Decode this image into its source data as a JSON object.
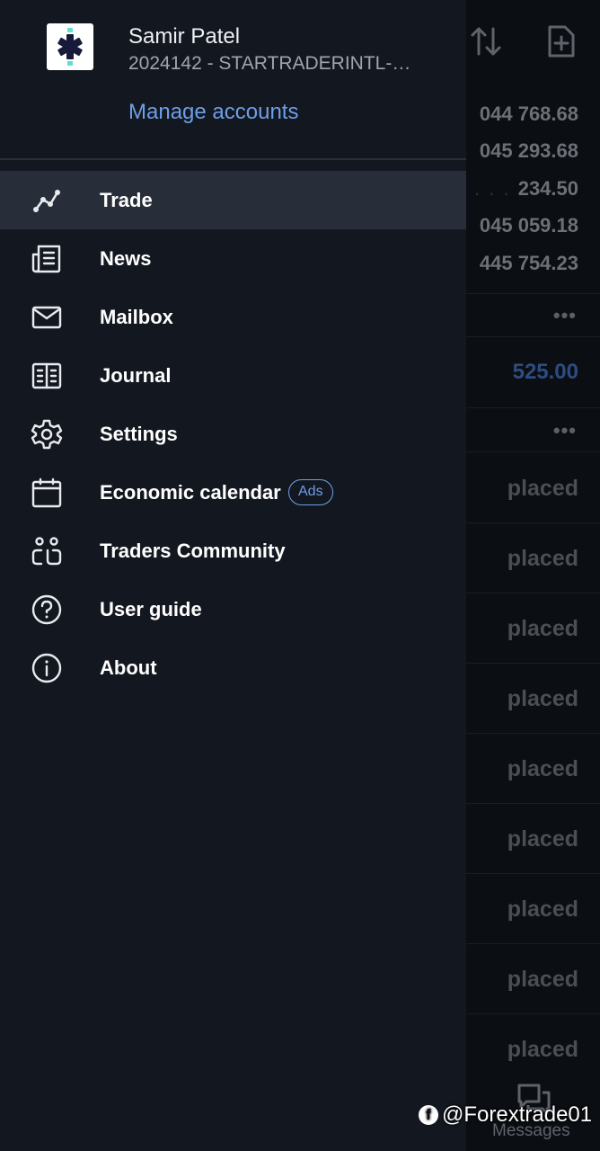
{
  "drawer": {
    "user_name": "Samir Patel",
    "account_id": "2024142 - STARTRADERINTL-…",
    "manage_accounts": "Manage accounts",
    "menu": [
      {
        "label": "Trade",
        "icon": "chart-line-icon",
        "active": true
      },
      {
        "label": "News",
        "icon": "news-icon"
      },
      {
        "label": "Mailbox",
        "icon": "mail-icon"
      },
      {
        "label": "Journal",
        "icon": "journal-icon"
      },
      {
        "label": "Settings",
        "icon": "gear-icon"
      },
      {
        "label": "Economic calendar",
        "icon": "calendar-icon",
        "badge": "Ads"
      },
      {
        "label": "Traders Community",
        "icon": "community-icon"
      },
      {
        "label": "User guide",
        "icon": "help-icon"
      },
      {
        "label": "About",
        "icon": "info-icon"
      }
    ]
  },
  "background": {
    "amounts": [
      "044 768.68",
      "045 293.68",
      "234.50",
      "045 059.18",
      "445 754.23"
    ],
    "more": "•••",
    "highlight_value": "525.00",
    "status_label": "placed",
    "messages_label": "Messages"
  },
  "watermark": {
    "text": "@Forextrade01"
  },
  "colors": {
    "drawer_bg": "#131820",
    "active_item_bg": "#272e39",
    "link": "#6e9ee8"
  }
}
